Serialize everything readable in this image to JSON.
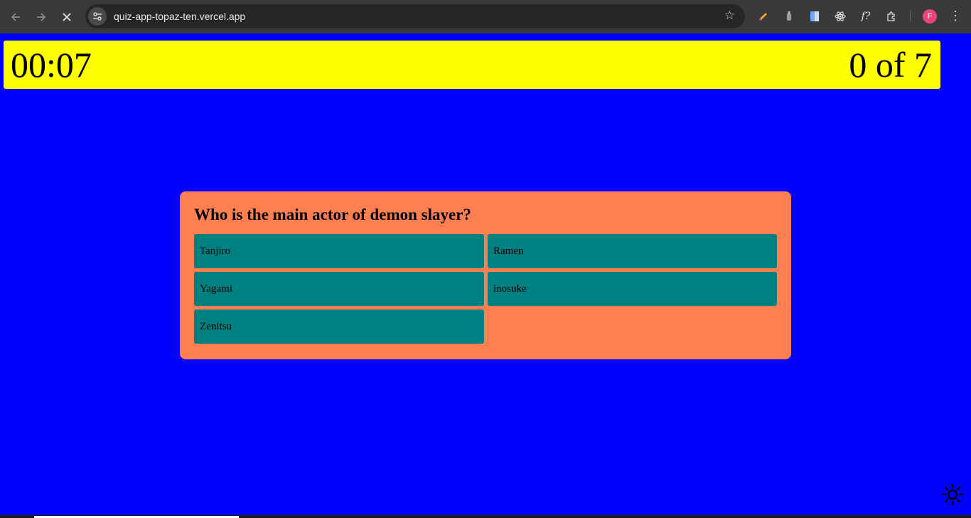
{
  "browser": {
    "url": "quiz-app-topaz-ten.vercel.app",
    "profile_initial": "F",
    "icons": [
      "back-icon",
      "forward-icon",
      "stop-loading-icon",
      "site-settings-icon",
      "bookmark-star-icon",
      "pen-extension-icon",
      "ink-extension-icon",
      "docs-extension-icon",
      "react-devtools-icon",
      "function-extension-icon",
      "extensions-puzzle-icon",
      "chrome-menu-icon"
    ]
  },
  "header": {
    "timer": "00:07",
    "progress": "0 of 7"
  },
  "quiz": {
    "question": "Who is the main actor of demon slayer?",
    "answers": [
      "Tanjiro",
      "Ramen",
      "Yagami",
      "inosuke",
      "Zenitsu"
    ]
  },
  "colors": {
    "background": "#0000ff",
    "header": "#ffff00",
    "card": "#ff7f50",
    "answer": "#008080"
  },
  "theme_toggle_icon": "sun-icon"
}
